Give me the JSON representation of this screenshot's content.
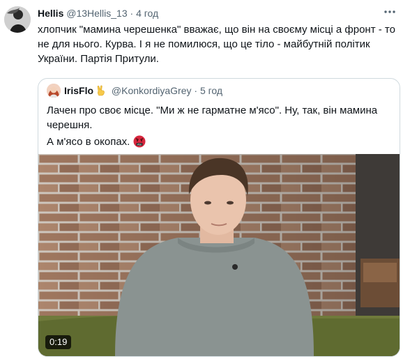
{
  "tweet": {
    "author_name": "Hellis",
    "author_handle": "@13Hellis_13",
    "separator": " · ",
    "time": "4 год",
    "more_icon": "more-icon",
    "text_lines": [
      "хлопчик \"мамина черешенка\" вважає, що він на своєму місці а фронт - то",
      "не для нього. Курва. І я не помилюся, що це тіло - майбутній політик",
      "України. Партія Притули."
    ]
  },
  "quote": {
    "author_name": "IrisFlo",
    "author_handle": "@KonkordiyaGrey",
    "separator": " · ",
    "time": "5 год",
    "badge_icon": "victory-hand-emoji",
    "lines": [
      "Лачен про своє місце. \"Ми ж не гарматне м'ясо\". Ну, так, він мамина",
      "черешня.",
      "А м'ясо в окопах."
    ],
    "end_emoji": "angry-cursing-face-emoji",
    "video": {
      "duration": "0:19",
      "scene": "young man in grey t-shirt in front of brick wall"
    }
  },
  "colors": {
    "text": "#0f1419",
    "muted": "#536471",
    "border": "#cfd9de",
    "brick": "#a9826a",
    "shirt": "#8a9391"
  }
}
